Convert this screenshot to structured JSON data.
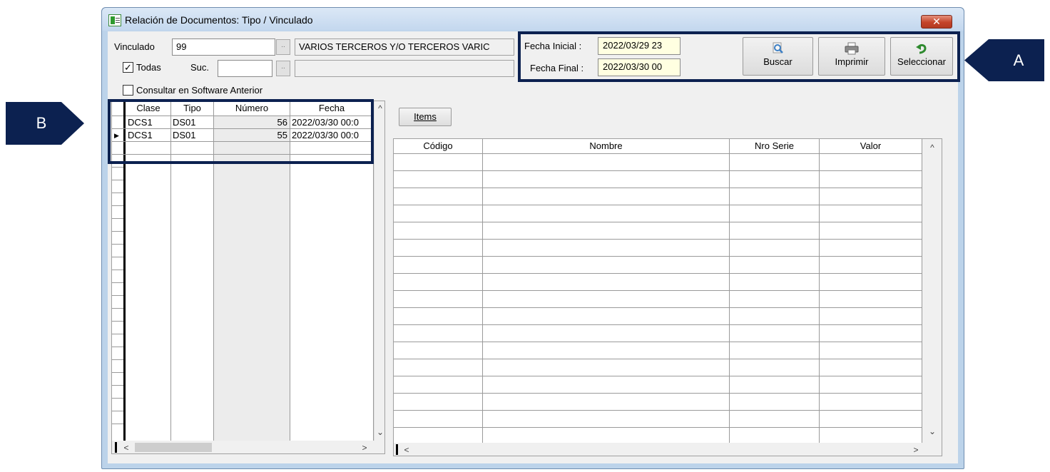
{
  "window": {
    "title": "Relación de Documentos: Tipo / Vinculado",
    "close_glyph": "✕"
  },
  "form": {
    "vinculado_label": "Vinculado",
    "vinculado_value": "99",
    "vinculado_name": "VARIOS TERCEROS Y/O TERCEROS VARIC",
    "dots": "..",
    "todas_label": "Todas",
    "todas_checked": true,
    "suc_label": "Suc.",
    "suc_value": "",
    "suc_name": "",
    "consultar_label": "Consultar en Software Anterior",
    "consultar_checked": false,
    "check_glyph": "✓",
    "fecha_inicial_label": "Fecha Inicial :",
    "fecha_inicial_value": "2022/03/29 23",
    "fecha_final_label": "Fecha Final :",
    "fecha_final_value": "2022/03/30 00"
  },
  "toolbar": {
    "buscar_label": "Buscar",
    "imprimir_label": "Imprimir",
    "seleccionar_label": "Seleccionar",
    "buscar_icon": "search-icon",
    "imprimir_icon": "printer-icon",
    "seleccionar_icon": "undo-arrow-icon"
  },
  "documents_grid": {
    "columns": [
      "Clase",
      "Tipo",
      "Número",
      "Fecha"
    ],
    "rows": [
      {
        "clase": "DCS1",
        "tipo": "DS01",
        "numero": "56",
        "fecha": "2022/03/30 00:0"
      },
      {
        "clase": "DCS1",
        "tipo": "DS01",
        "numero": "55",
        "fecha": "2022/03/30 00:0"
      }
    ],
    "current_row_glyph": "▶"
  },
  "items": {
    "button_label": "Items",
    "columns": [
      "Código",
      "Nombre",
      "Nro Serie",
      "Valor"
    ]
  },
  "scroll": {
    "up": "^",
    "down": "⌄",
    "left": "<",
    "right": ">"
  },
  "annotations": {
    "a": "A",
    "b": "B"
  },
  "colors": {
    "annotation": "#0c2150",
    "date_field_bg": "#ffffe1",
    "close_button": "#c4442a"
  }
}
